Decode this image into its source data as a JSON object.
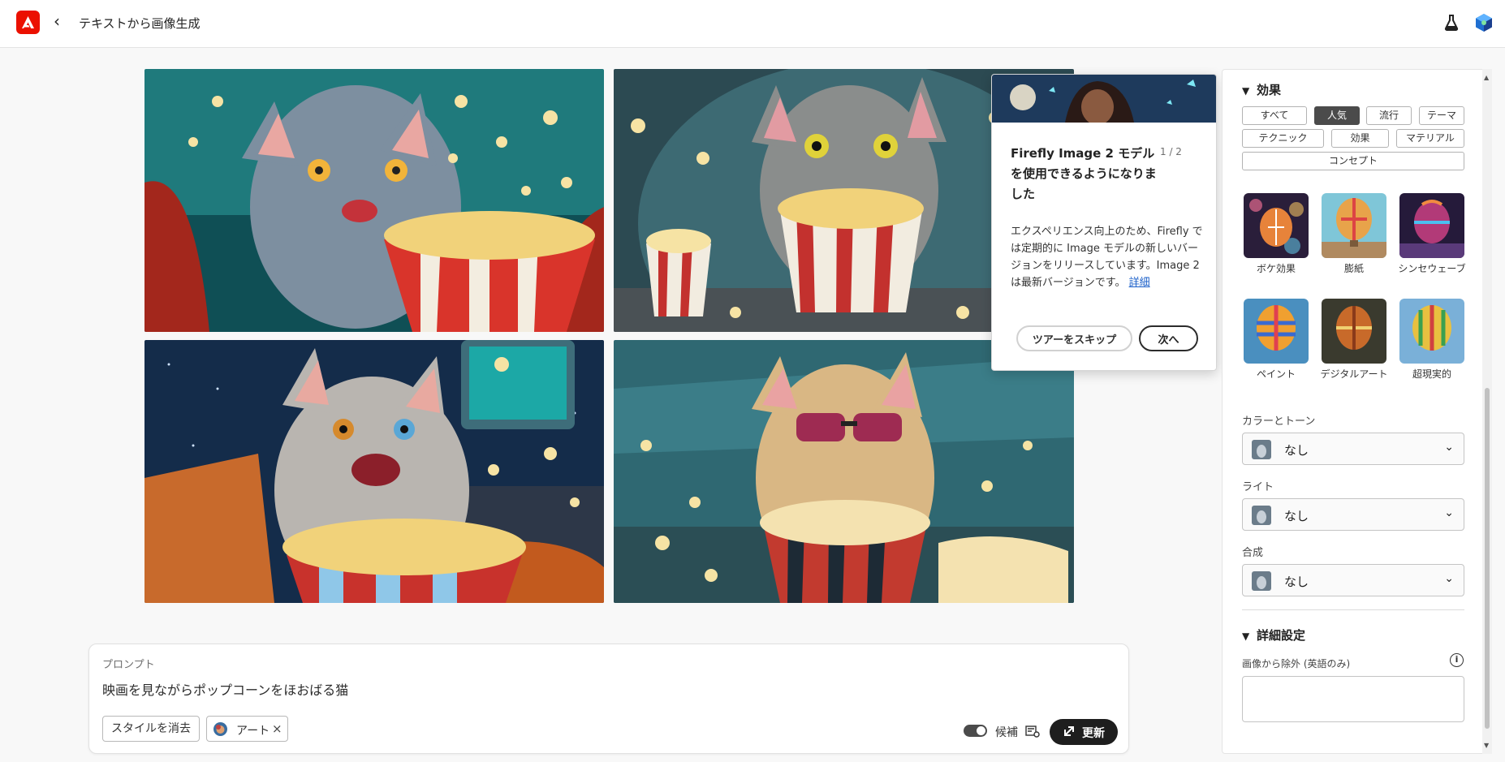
{
  "header": {
    "title": "テキストから画像生成",
    "logo_icon": "adobe-logo",
    "back_icon": "chevron-left-icon",
    "labs_icon": "flask-icon",
    "avatar_icon": "user-avatar"
  },
  "gallery": {
    "images": [
      {
        "alt": "cat-popcorn-1"
      },
      {
        "alt": "cat-popcorn-2"
      },
      {
        "alt": "cat-popcorn-3"
      },
      {
        "alt": "cat-popcorn-4"
      }
    ]
  },
  "prompt": {
    "label": "プロンプト",
    "text": "映画を見ながらポップコーンをほおばる猫",
    "clear_style": "スタイルを消去",
    "chip_label": "アート",
    "chip_close": "×",
    "candidate_label": "候補",
    "update_label": "更新"
  },
  "popover": {
    "title": "Firefly Image 2 モデルを使用できるようになりました",
    "step": "1 / 2",
    "body": "エクスペリエンス向上のため、Firefly では定期的に Image モデルの新しいバージョンをリリースしています。Image 2 は最新バージョンです。",
    "link": "詳細",
    "skip": "ツアーをスキップ",
    "next": "次へ"
  },
  "panel": {
    "effects_title": "効果",
    "filters": [
      "すべて",
      "人気",
      "流行",
      "テーマ",
      "テクニック",
      "効果",
      "マテリアル",
      "コンセプト"
    ],
    "active_filter": "人気",
    "styles": [
      "ボケ効果",
      "膨紙",
      "シンセウェーブ",
      "ペイント",
      "デジタルアート",
      "超現実的"
    ],
    "color_tone_label": "カラーとトーン",
    "color_tone_value": "なし",
    "light_label": "ライト",
    "light_value": "なし",
    "composition_label": "合成",
    "composition_value": "なし",
    "advanced_title": "詳細設定",
    "exclude_label": "画像から除外 (英語のみ)",
    "exclude_value": ""
  },
  "colors": {
    "accent": "#eb1000",
    "dark_button": "#1e1e1e",
    "link": "#1a5fc9"
  }
}
